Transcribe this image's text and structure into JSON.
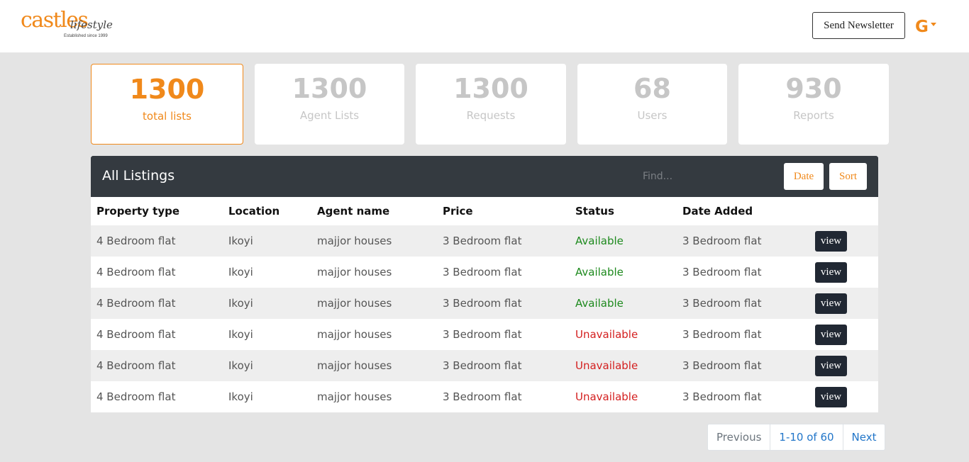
{
  "header": {
    "logo": {
      "main": "castles",
      "script": "lifestyle",
      "tagline": "Established since 1999"
    },
    "newsletter_label": "Send Newsletter",
    "profile_initial": "G",
    "accent_color": "#f0891b"
  },
  "stats": [
    {
      "value": "1300",
      "label": "total lists"
    },
    {
      "value": "1300",
      "label": "Agent Lists"
    },
    {
      "value": "1300",
      "label": "Requests"
    },
    {
      "value": "68",
      "label": "Users"
    },
    {
      "value": "930",
      "label": "Reports"
    }
  ],
  "listings": {
    "title": "All Listings",
    "find_placeholder": "Find...",
    "date_label": "Date",
    "sort_label": "Sort",
    "columns": [
      "Property type",
      "Location",
      "Agent name",
      "Price",
      "Status",
      "Date Added"
    ],
    "rows": [
      {
        "property_type": "4 Bedroom flat",
        "location": "Ikoyi",
        "agent": "majjor houses",
        "price": "3 Bedroom flat",
        "status": "Available",
        "date_added": "3 Bedroom flat",
        "action": "view"
      },
      {
        "property_type": "4 Bedroom flat",
        "location": "Ikoyi",
        "agent": "majjor houses",
        "price": "3 Bedroom flat",
        "status": "Available",
        "date_added": "3 Bedroom flat",
        "action": "view"
      },
      {
        "property_type": "4 Bedroom flat",
        "location": "Ikoyi",
        "agent": "majjor houses",
        "price": "3 Bedroom flat",
        "status": "Available",
        "date_added": "3 Bedroom flat",
        "action": "view"
      },
      {
        "property_type": "4 Bedroom flat",
        "location": "Ikoyi",
        "agent": "majjor houses",
        "price": "3 Bedroom flat",
        "status": "Unavailable",
        "date_added": "3 Bedroom flat",
        "action": "view"
      },
      {
        "property_type": "4 Bedroom flat",
        "location": "Ikoyi",
        "agent": "majjor houses",
        "price": "3 Bedroom flat",
        "status": "Unavailable",
        "date_added": "3 Bedroom flat",
        "action": "view"
      },
      {
        "property_type": "4 Bedroom flat",
        "location": "Ikoyi",
        "agent": "majjor houses",
        "price": "3 Bedroom flat",
        "status": "Unavailable",
        "date_added": "3 Bedroom flat",
        "action": "view"
      }
    ],
    "status_colors": {
      "Available": "#1e8a1e",
      "Unavailable": "#d42020"
    }
  },
  "pagination": {
    "previous": "Previous",
    "range": "1-10 of 60",
    "next": "Next"
  }
}
